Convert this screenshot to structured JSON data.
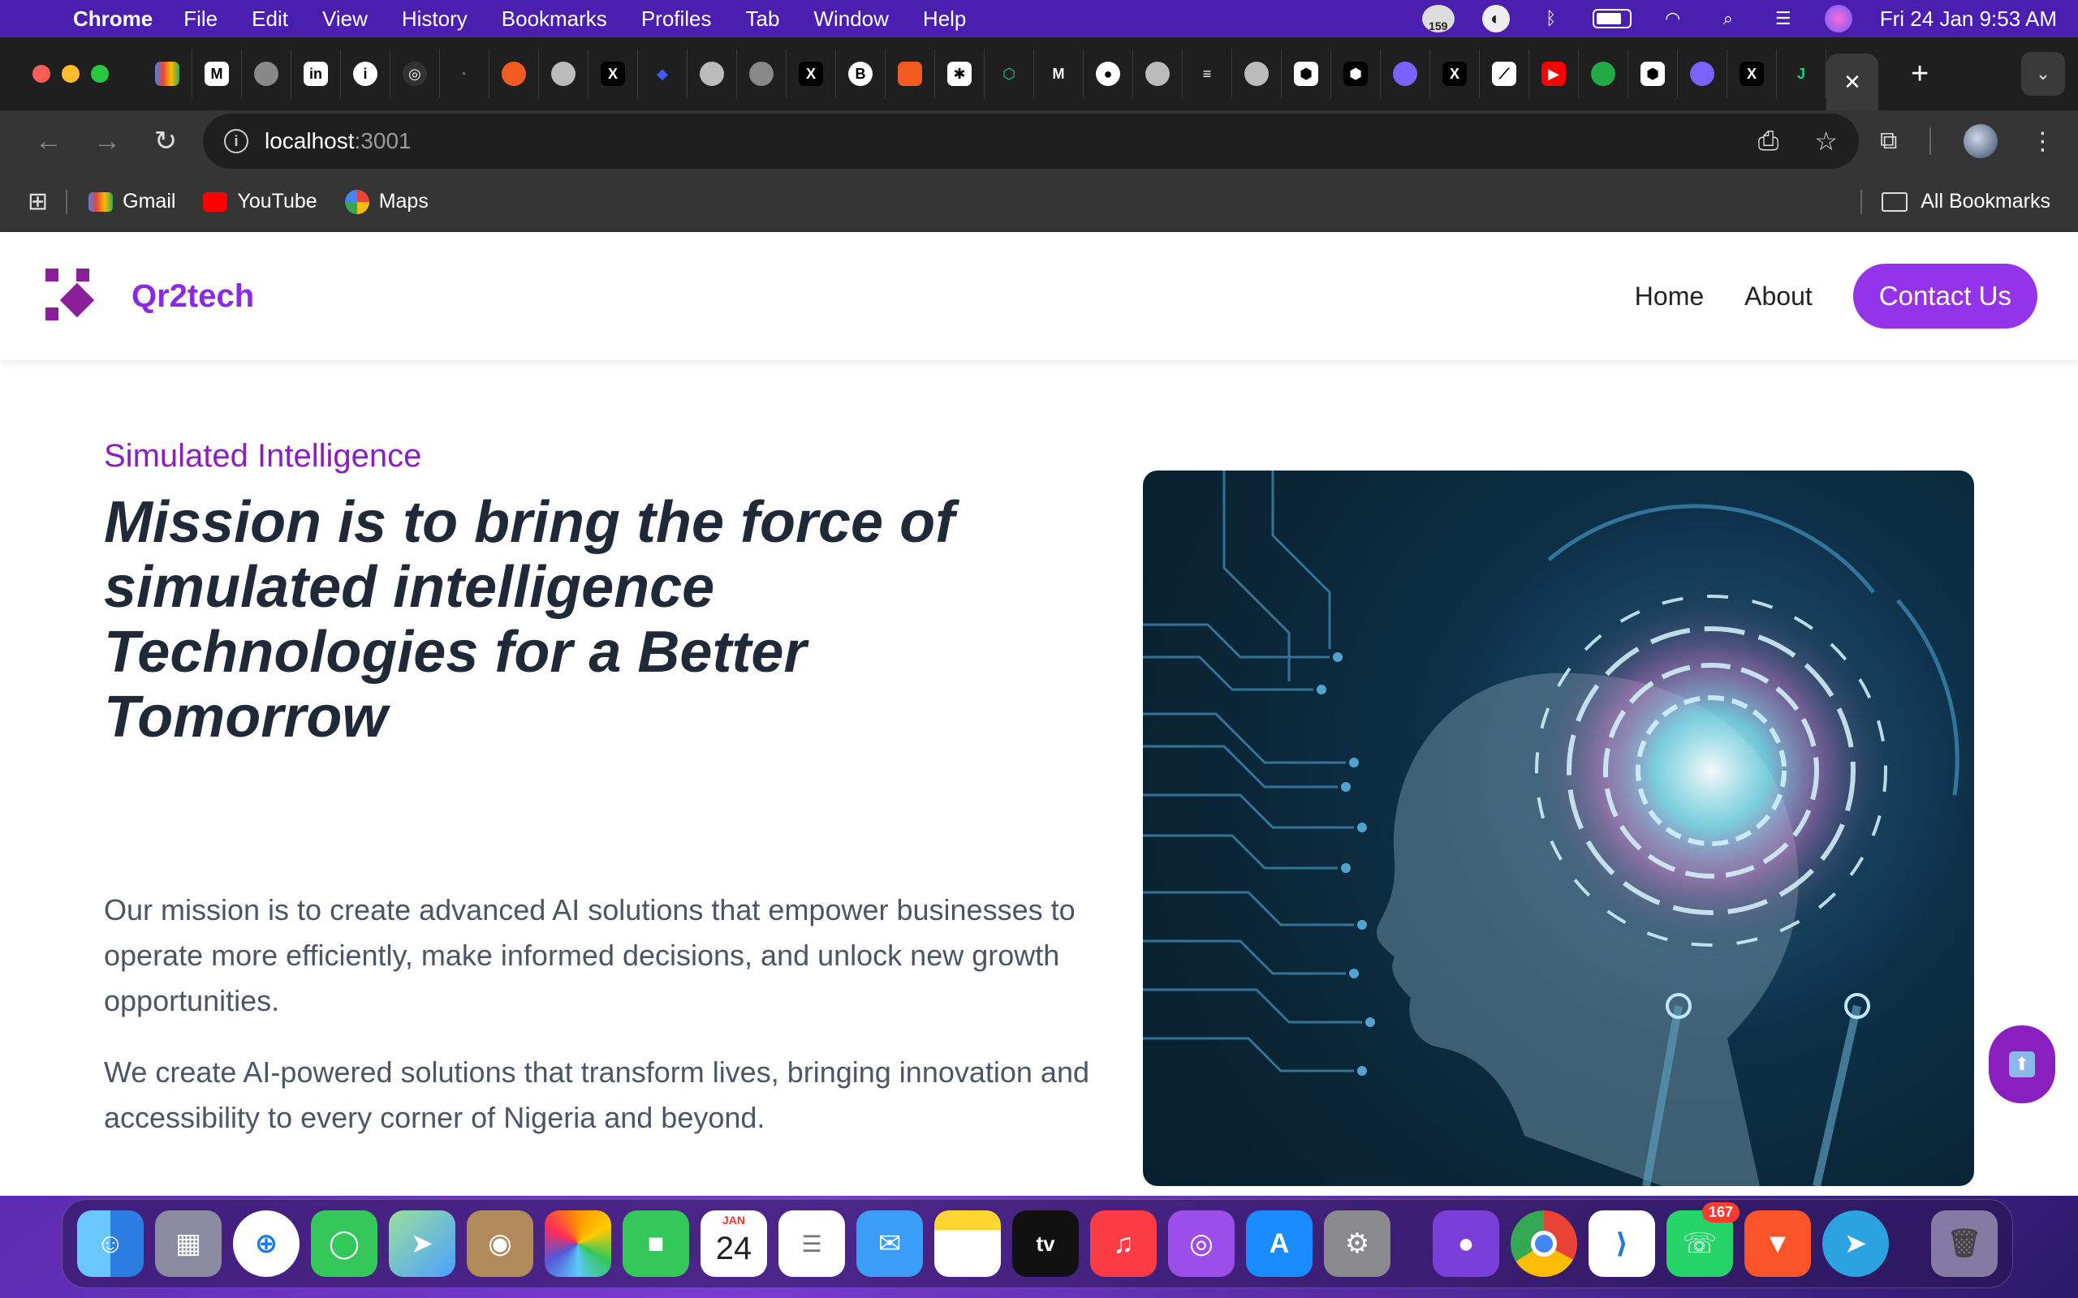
{
  "menubar": {
    "app_name": "Chrome",
    "items": [
      "File",
      "Edit",
      "View",
      "History",
      "Bookmarks",
      "Profiles",
      "Tab",
      "Window",
      "Help"
    ],
    "badge_count": "159",
    "clock": "Fri 24 Jan  9:53 AM"
  },
  "browser": {
    "active_tab_close": "✕",
    "new_tab": "+",
    "url_host": "localhost",
    "url_port": ":3001",
    "bookmarks": [
      {
        "label": "Gmail"
      },
      {
        "label": "YouTube"
      },
      {
        "label": "Maps"
      }
    ],
    "all_bookmarks": "All Bookmarks"
  },
  "site": {
    "brand": "Qr2tech",
    "nav": {
      "home": "Home",
      "about": "About",
      "contact": "Contact Us"
    },
    "hero": {
      "eyebrow": "Simulated Intelligence",
      "title": "Mission is to bring the force of simulated intelligence Technologies for a Better Tomorrow",
      "para1": "Our mission is to create advanced AI solutions that empower businesses to operate more efficiently, make informed decisions, and unlock new growth opportunities.",
      "para2": "We create AI-powered solutions that transform lives, bringing innovation and accessibility to every corner of Nigeria and beyond."
    }
  },
  "dock": {
    "calendar_month": "JAN",
    "calendar_day": "24",
    "whatsapp_badge": "167"
  },
  "colors": {
    "brand_purple": "#9333ea",
    "eyebrow_purple": "#8a1fc0",
    "heading": "#1f2937",
    "body_text": "#4b5563"
  }
}
